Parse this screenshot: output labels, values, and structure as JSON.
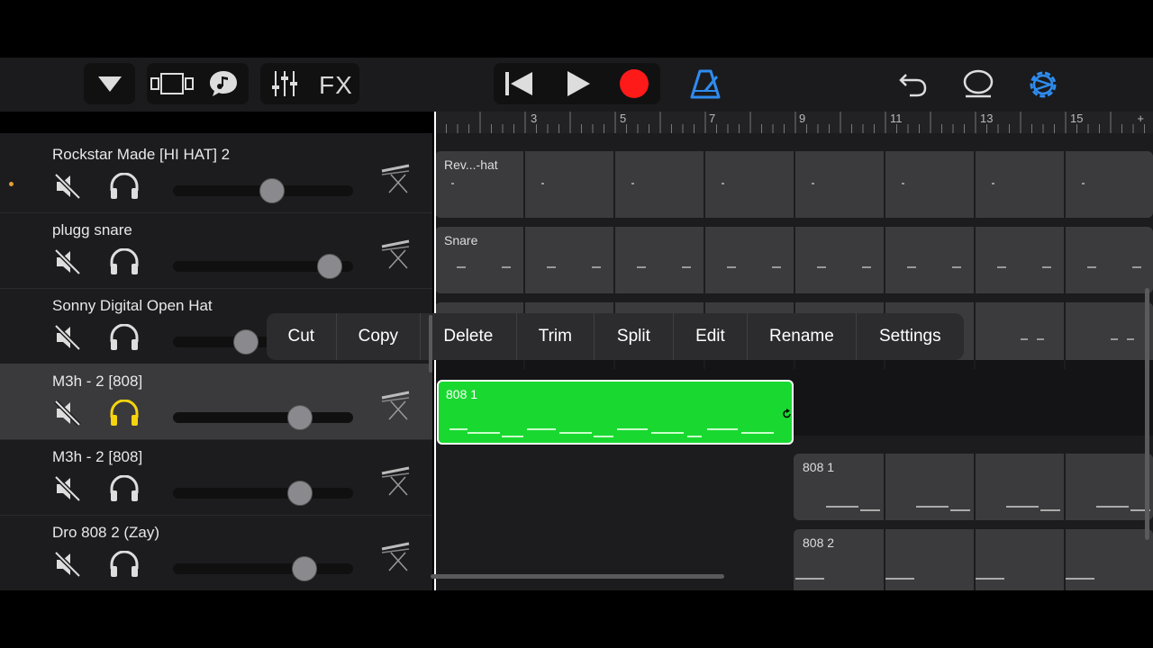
{
  "toolbar": {
    "fx_label": "FX",
    "icons": [
      "dropdown-triangle-icon",
      "view-toggle-icon",
      "smart-controls-icon",
      "mixer-icon",
      "rewind-icon",
      "play-icon",
      "record-icon",
      "metronome-icon",
      "undo-icon",
      "loop-browser-icon",
      "settings-gear-icon"
    ],
    "record_color": "#ff1a1a",
    "accent_color": "#2e8cf0"
  },
  "ruler": {
    "bars": [
      "3",
      "5",
      "7",
      "9",
      "11",
      "13",
      "15"
    ],
    "add_label": "+"
  },
  "tracks": [
    {
      "name": "Rockstar Made [HI HAT] 2",
      "volume": 0.56,
      "soloed": false,
      "selected": false
    },
    {
      "name": "plugg snare",
      "volume": 0.93,
      "soloed": false,
      "selected": false
    },
    {
      "name": "Sonny Digital Open Hat",
      "volume": 0.39,
      "soloed": false,
      "selected": false
    },
    {
      "name": "M3h - 2 [808]",
      "volume": 0.74,
      "soloed": true,
      "selected": true
    },
    {
      "name": "M3h - 2 [808]",
      "volume": 0.74,
      "soloed": false,
      "selected": false
    },
    {
      "name": "Dro 808 2 (Zay)",
      "volume": 0.77,
      "soloed": false,
      "selected": false
    }
  ],
  "regions": {
    "hihat": "Rev...-hat",
    "snare": "Snare",
    "selected": "808 1",
    "lane5": "808 1",
    "lane6": "808 2"
  },
  "context_menu": [
    "Cut",
    "Copy",
    "Delete",
    "Trim",
    "Split",
    "Edit",
    "Rename",
    "Settings"
  ],
  "colors": {
    "selected_region": "#19d931",
    "solo_active": "#f5d40f"
  }
}
